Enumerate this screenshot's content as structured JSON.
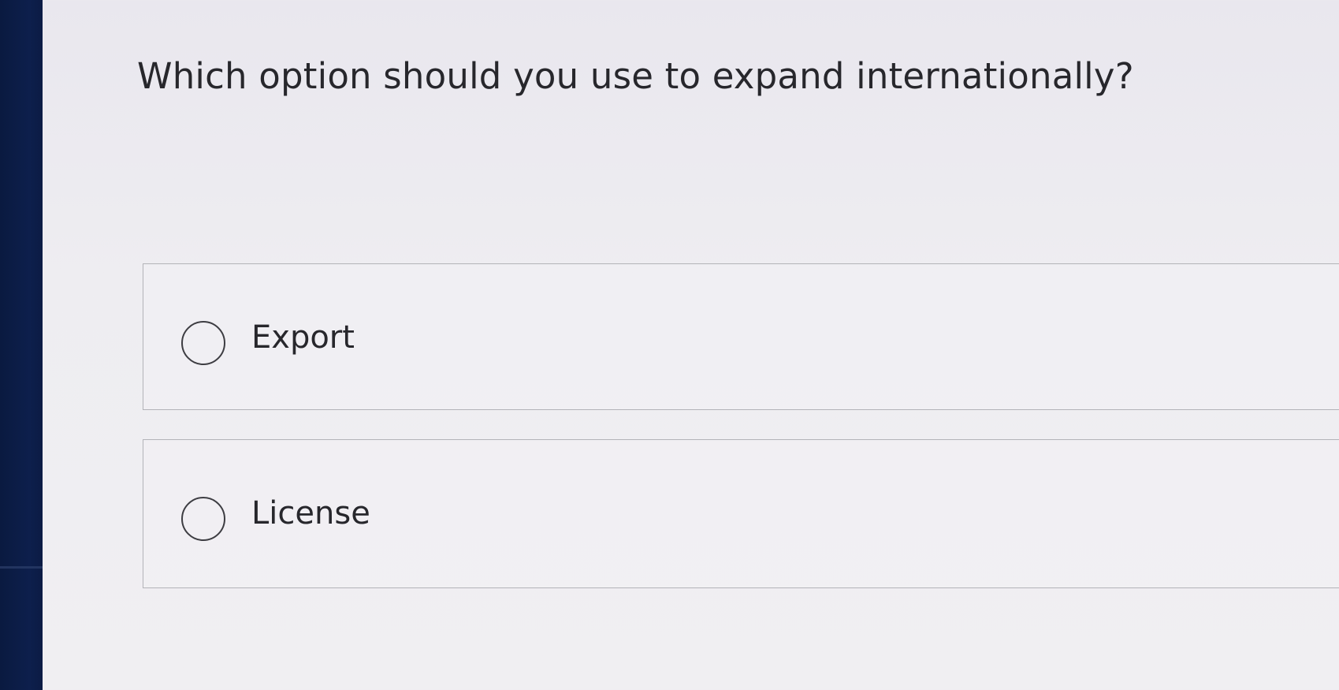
{
  "question": {
    "text": "Which option should you use to expand internationally?"
  },
  "options": [
    {
      "label": "Export",
      "selected": false
    },
    {
      "label": "License",
      "selected": false
    }
  ],
  "colors": {
    "side_bar": "#0d1f4c",
    "background": "#eeedf1",
    "border": "#b3b3b8",
    "text": "#27272c"
  }
}
